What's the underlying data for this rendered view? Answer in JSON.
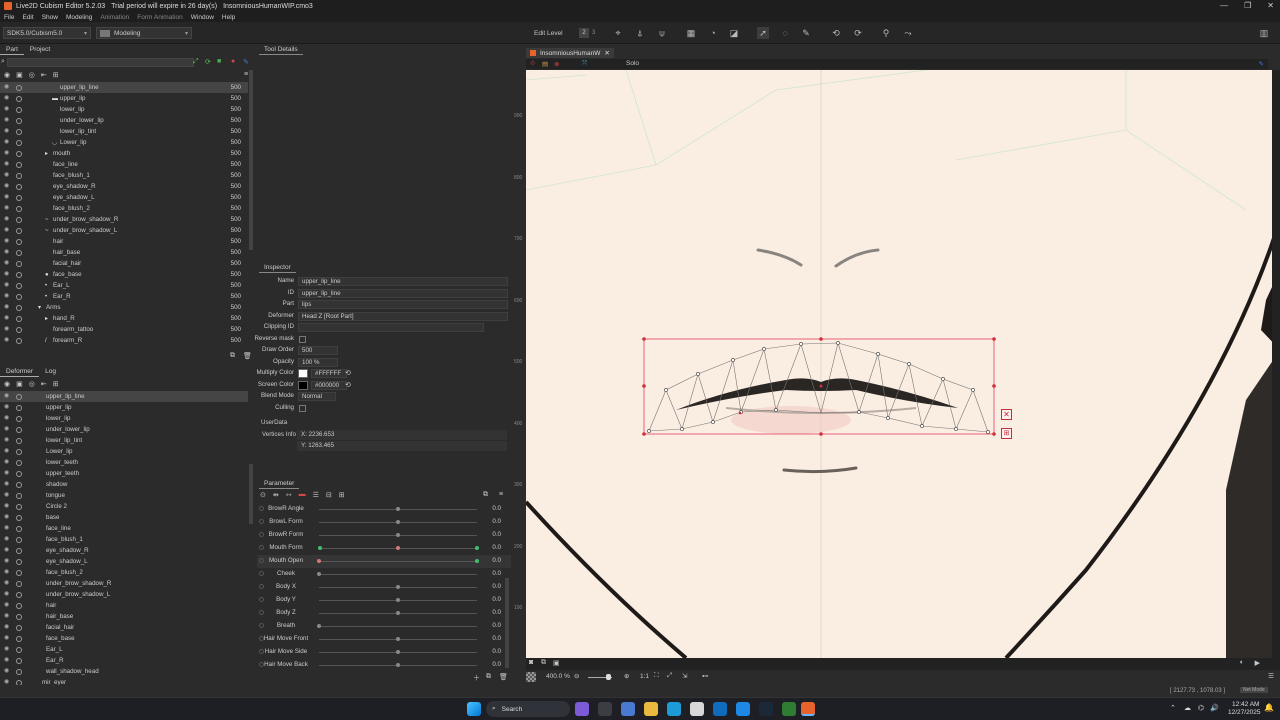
{
  "window": {
    "title": "Live2D Cubism Editor 5.2.03",
    "trial": "Trial period will expire in 26 day(s)",
    "file": "InsomniousHumanWIP.cmo3"
  },
  "menu": [
    "File",
    "Edit",
    "Show",
    "Modeling",
    "Animation",
    "Form Animation",
    "Window",
    "Help"
  ],
  "toolbar": {
    "sdk": "SDK5.0/Cubism5.0",
    "mode": "Modeling",
    "edit_level_label": "Edit Level",
    "edit_levels": [
      "1",
      "2",
      "3"
    ]
  },
  "part_panel": {
    "tabs": [
      "Part",
      "Project"
    ],
    "rows": [
      {
        "label": "upper_lip_line",
        "value": "500",
        "indent": 60,
        "selected": true,
        "glyph": ""
      },
      {
        "label": "upper_lip",
        "value": "500",
        "indent": 60,
        "glyph": "▬"
      },
      {
        "label": "lower_lip",
        "value": "500",
        "indent": 60,
        "glyph": ""
      },
      {
        "label": "under_lower_lip",
        "value": "500",
        "indent": 60,
        "glyph": ""
      },
      {
        "label": "lower_lip_tint",
        "value": "500",
        "indent": 60,
        "glyph": ""
      },
      {
        "label": "Lower_lip",
        "value": "500",
        "indent": 60,
        "glyph": "◡"
      },
      {
        "label": "mouth",
        "value": "500",
        "indent": 53,
        "glyph": "▸"
      },
      {
        "label": "face_line",
        "value": "500",
        "indent": 53,
        "glyph": ""
      },
      {
        "label": "face_blush_1",
        "value": "500",
        "indent": 53,
        "glyph": ""
      },
      {
        "label": "eye_shadow_R",
        "value": "500",
        "indent": 53,
        "glyph": ""
      },
      {
        "label": "eye_shadow_L",
        "value": "500",
        "indent": 53,
        "glyph": ""
      },
      {
        "label": "face_blush_2",
        "value": "500",
        "indent": 53,
        "glyph": ""
      },
      {
        "label": "under_brow_shadow_R",
        "value": "500",
        "indent": 53,
        "glyph": "~"
      },
      {
        "label": "under_brow_shadow_L",
        "value": "500",
        "indent": 53,
        "glyph": "~"
      },
      {
        "label": "hair",
        "value": "500",
        "indent": 53,
        "glyph": ""
      },
      {
        "label": "hair_base",
        "value": "500",
        "indent": 53,
        "glyph": ""
      },
      {
        "label": "facial_hair",
        "value": "500",
        "indent": 53,
        "glyph": ""
      },
      {
        "label": "face_base",
        "value": "500",
        "indent": 53,
        "glyph": "●"
      },
      {
        "label": "Ear_L",
        "value": "500",
        "indent": 53,
        "glyph": "•"
      },
      {
        "label": "Ear_R",
        "value": "500",
        "indent": 53,
        "glyph": "•"
      },
      {
        "label": "Arms",
        "value": "500",
        "indent": 46,
        "glyph": "▾"
      },
      {
        "label": "hand_R",
        "value": "500",
        "indent": 53,
        "glyph": "▸"
      },
      {
        "label": "forearm_tattoo",
        "value": "500",
        "indent": 53,
        "glyph": ""
      },
      {
        "label": "forearm_R",
        "value": "500",
        "indent": 53,
        "glyph": "/"
      }
    ]
  },
  "deformer_panel": {
    "tabs": [
      "Deformer",
      "Log"
    ],
    "rows": [
      {
        "label": "upper_lip_line",
        "indent": 46,
        "selected": true
      },
      {
        "label": "upper_lip",
        "indent": 46
      },
      {
        "label": "lower_lip",
        "indent": 46
      },
      {
        "label": "under_lower_lip",
        "indent": 46
      },
      {
        "label": "lower_lip_tint",
        "indent": 46
      },
      {
        "label": "Lower_lip",
        "indent": 46
      },
      {
        "label": "lower_teeth",
        "indent": 46
      },
      {
        "label": "upper_teeth",
        "indent": 46
      },
      {
        "label": "shadow",
        "indent": 46
      },
      {
        "label": "tongue",
        "indent": 46
      },
      {
        "label": "Circle 2",
        "indent": 46
      },
      {
        "label": "base",
        "indent": 46
      },
      {
        "label": "face_line",
        "indent": 46
      },
      {
        "label": "face_blush_1",
        "indent": 46
      },
      {
        "label": "eye_shadow_R",
        "indent": 46
      },
      {
        "label": "eye_shadow_L",
        "indent": 46
      },
      {
        "label": "face_blush_2",
        "indent": 46
      },
      {
        "label": "under_brow_shadow_R",
        "indent": 46
      },
      {
        "label": "under_brow_shadow_L",
        "indent": 46
      },
      {
        "label": "hair",
        "indent": 46
      },
      {
        "label": "hair_base",
        "indent": 46
      },
      {
        "label": "facial_hair",
        "indent": 46
      },
      {
        "label": "face_base",
        "indent": 46
      },
      {
        "label": "Ear_L",
        "indent": 46
      },
      {
        "label": "Ear_R",
        "indent": 46
      },
      {
        "label": "wall_shadow_head",
        "indent": 46
      },
      {
        "label": "mir_eyer",
        "indent": 42
      }
    ]
  },
  "tool_details": {
    "title": "Tool Details"
  },
  "inspector": {
    "title": "Inspector",
    "fields": [
      {
        "key": "Name",
        "value": "upper_lip_line"
      },
      {
        "key": "ID",
        "value": "upper_lip_line"
      },
      {
        "key": "Part",
        "value": "lips"
      },
      {
        "key": "Deformer",
        "value": "Head Z  [Root Part]"
      },
      {
        "key": "Clipping ID",
        "value": ""
      },
      {
        "key": "Reverse mask",
        "value": ""
      },
      {
        "key": "Draw Order",
        "value": "500"
      },
      {
        "key": "Opacity",
        "value": "100 %"
      },
      {
        "key": "Multiply Color",
        "value": "#FFFFFF"
      },
      {
        "key": "Screen Color",
        "value": "#000000"
      },
      {
        "key": "Blend Mode",
        "value": "Normal"
      },
      {
        "key": "Culling",
        "value": ""
      }
    ],
    "userdata": "UserData",
    "vertices_label": "Vertices Info",
    "vx": "X: 2236.653",
    "vy": "Y: 1263.465"
  },
  "parameter": {
    "title": "Parameter",
    "rows": [
      {
        "name": "BrowR Angle",
        "value": "0.0",
        "level": 0.5
      },
      {
        "name": "BrowL Form",
        "value": "0.0",
        "level": 0.5
      },
      {
        "name": "BrowR Form",
        "value": "0.0",
        "level": 0.5
      },
      {
        "name": "Mouth Form",
        "value": "0.0",
        "level": 0.5
      },
      {
        "name": "Mouth Open",
        "value": "0.0",
        "level": 0.0
      },
      {
        "name": "Cheek",
        "value": "0.0",
        "level": 0.0
      },
      {
        "name": "Body X",
        "value": "0.0",
        "level": 0.5
      },
      {
        "name": "Body Y",
        "value": "0.0",
        "level": 0.5
      },
      {
        "name": "Body Z",
        "value": "0.0",
        "level": 0.5
      },
      {
        "name": "Breath",
        "value": "0.0",
        "level": 0.0
      },
      {
        "name": "Hair Move Front",
        "value": "0.0",
        "level": 0.5
      },
      {
        "name": "Hair Move Side",
        "value": "0.0",
        "level": 0.5
      },
      {
        "name": "Hair Move Back",
        "value": "0.0",
        "level": 0.5
      }
    ]
  },
  "canvas": {
    "tab": "InsomniousHumanW",
    "solo": "Solo",
    "ruler": [
      "900",
      "800",
      "700",
      "600",
      "500",
      "400",
      "300",
      "200",
      "100"
    ],
    "zoom": "400.0 %",
    "ratio": "1:1",
    "coords": "[ 2127.73 , 1078.03 ]",
    "zoom_badge": "Net Mode"
  },
  "taskbar": {
    "search": "Search",
    "time": "12:42 AM",
    "date": "12/27/2025"
  }
}
